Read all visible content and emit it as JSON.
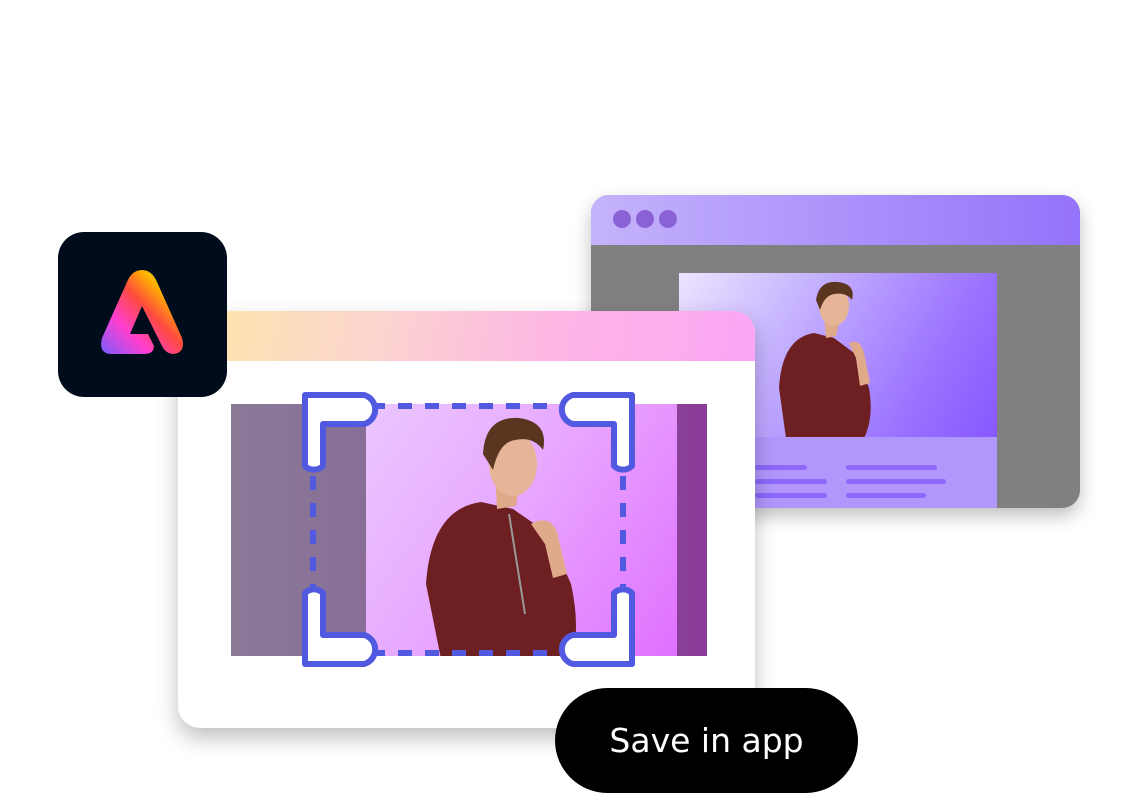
{
  "button": {
    "label": "Save in app"
  },
  "colors": {
    "crop_frame": "#5059e0",
    "button_bg": "#000000",
    "logo_bg": "#000c1c",
    "back_window_bar": "#9473fb",
    "back_window_body": "#808080"
  },
  "icons": {
    "logo": "adobe-express-logo-icon",
    "crop": "crop-frame-icon"
  }
}
